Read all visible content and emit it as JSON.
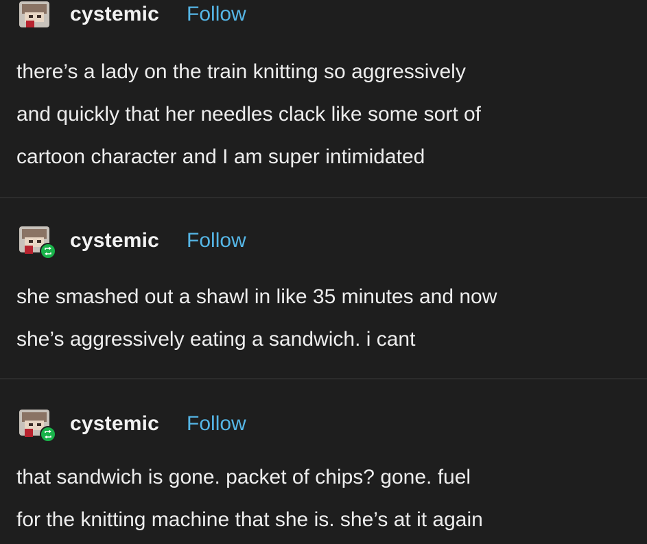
{
  "posts": [
    {
      "username": "cystemic",
      "follow_label": "Follow",
      "is_reblog": false,
      "text": "there’s a lady on the train knitting so aggressively\nand quickly that her needles clack like some sort of\ncartoon character and I am super intimidated"
    },
    {
      "username": "cystemic",
      "follow_label": "Follow",
      "is_reblog": true,
      "text": "she smashed out a shawl in like 35 minutes and now\nshe’s aggressively eating a sandwich. i cant"
    },
    {
      "username": "cystemic",
      "follow_label": "Follow",
      "is_reblog": true,
      "text": "that sandwich is gone. packet of chips? gone. fuel\nfor the knitting machine that she is. she’s at it again"
    }
  ],
  "colors": {
    "background": "#1e1e1e",
    "follow_link": "#55b6e6",
    "reblog_badge": "#19b34a",
    "text": "#ededed"
  },
  "icons": {
    "avatar": "avatar-icon",
    "reblog": "reblog-icon"
  }
}
